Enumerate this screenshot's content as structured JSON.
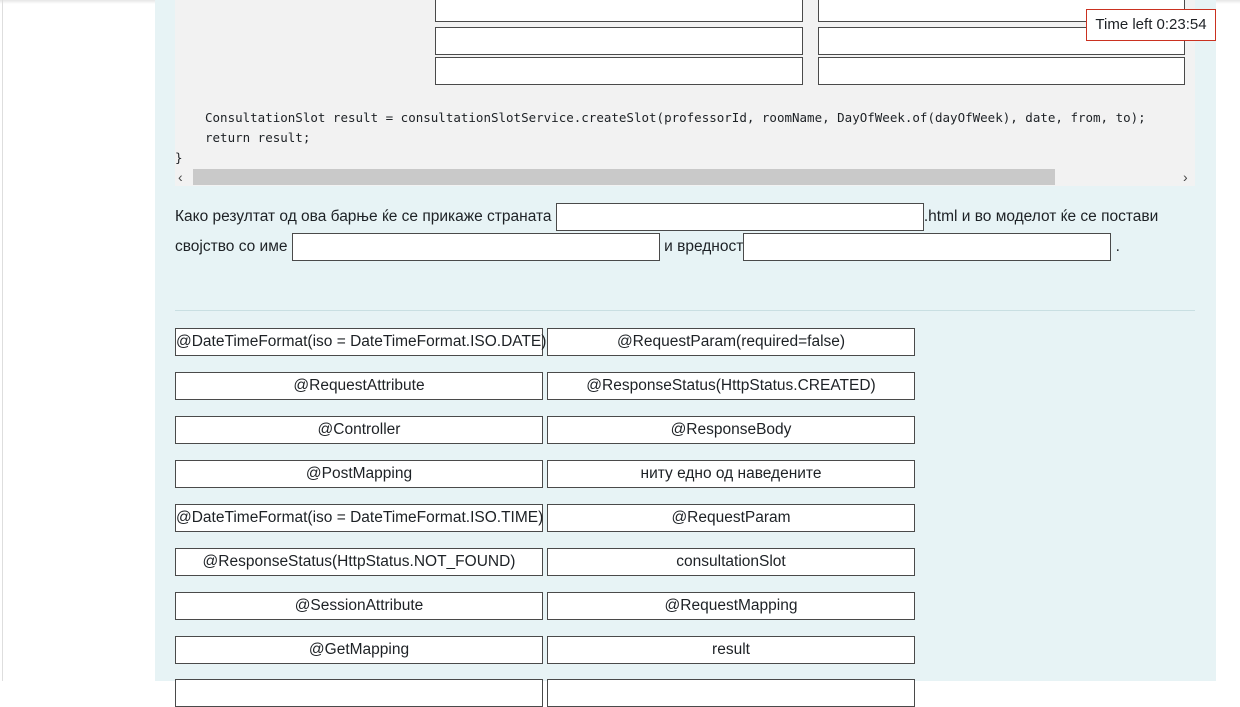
{
  "timer": {
    "label": "Time left 0:23:54"
  },
  "code": {
    "line1": "ConsultationSlot result = consultationSlotService.createSlot(professorId, roomName, DayOfWeek.of(dayOfWeek), date, from, to);",
    "line2": "return result;",
    "line3": "}"
  },
  "scrollbar": {
    "left_arrow": "‹",
    "right_arrow": "›"
  },
  "question": {
    "part1": "Како резултат од ова барње ќе се прикаже страната",
    "part2": ".html и во моделот ќе се постави",
    "part3": "својство со име",
    "part4": "и вредност",
    "part5": "."
  },
  "choices": [
    "@DateTimeFormat(iso = DateTimeFormat.ISO.DATE)",
    "@RequestParam(required=false)",
    "@RequestAttribute",
    "@ResponseStatus(HttpStatus.CREATED)",
    "@Controller",
    "@ResponseBody",
    "@PostMapping",
    "ниту едно од наведените",
    "@DateTimeFormat(iso = DateTimeFormat.ISO.TIME)",
    "@RequestParam",
    "@ResponseStatus(HttpStatus.NOT_FOUND)",
    "consultationSlot",
    "@SessionAttribute",
    "@RequestMapping",
    "@GetMapping",
    "result"
  ]
}
